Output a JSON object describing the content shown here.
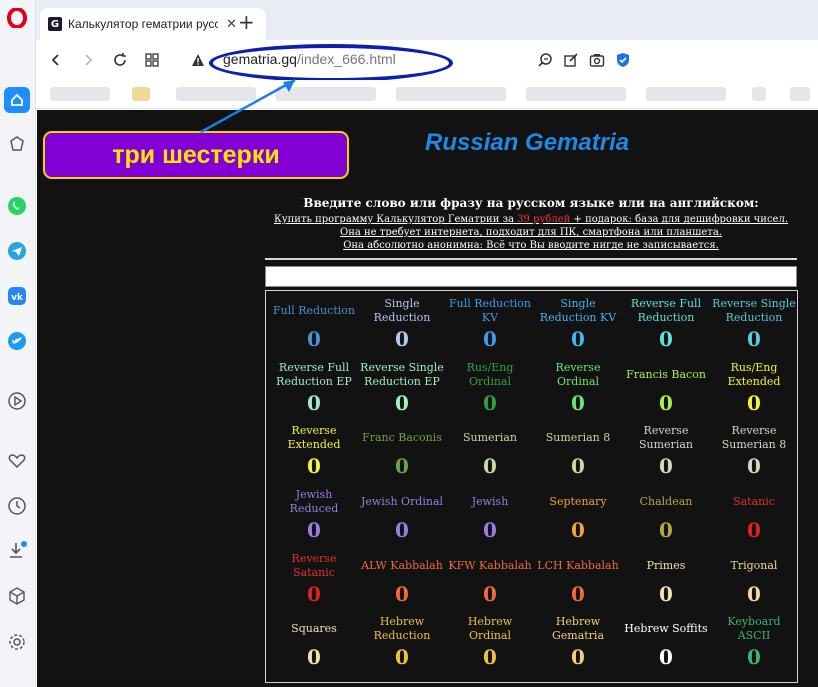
{
  "browser": {
    "tab_title": "Калькулятор гематрии русс",
    "tab_close": "✕",
    "new_tab": "+",
    "url_host": "gematria.gq",
    "url_path": "/index_666.html"
  },
  "page": {
    "site_title": "Russian Gematria",
    "badge_text": "три шестерки",
    "instr_head": "Введите слово или фразу на русском языке или на английском:",
    "instr_line1_a": "Купить программу Калькулятор Гематрии за ",
    "instr_line1_price": "39 рублей",
    "instr_line1_b": " + подарок: база для дешифровки чисел.",
    "instr_line2": "Она не требует интернета, подходит для ПК, смартфона или планшета.",
    "instr_line3": "Она абсолютно анонимна: Всё что Вы вводите нигде не записывается.",
    "input_value": ""
  },
  "ciphers": [
    {
      "label": "Full Reduction",
      "value": "0",
      "label_color": "#4a8fd6",
      "value_color": "#4a8fd6"
    },
    {
      "label": "Single Reduction",
      "value": "0",
      "label_color": "#b8c6ee",
      "value_color": "#b8c6ee"
    },
    {
      "label": "Full Reduction KV",
      "value": "0",
      "label_color": "#3d9be9",
      "value_color": "#3d9be9"
    },
    {
      "label": "Single Reduction KV",
      "value": "0",
      "label_color": "#42b4f0",
      "value_color": "#42b4f0"
    },
    {
      "label": "Reverse Full Reduction",
      "value": "0",
      "label_color": "#5fe0e0",
      "value_color": "#5fe0e0"
    },
    {
      "label": "Reverse Single Reduction",
      "value": "0",
      "label_color": "#5cc8d8",
      "value_color": "#5cc8d8"
    },
    {
      "label": "Reverse Full Reduction EP",
      "value": "0",
      "label_color": "#9ee8c8",
      "value_color": "#9ee8c8"
    },
    {
      "label": "Reverse Single Reduction EP",
      "value": "0",
      "label_color": "#9ef0c0",
      "value_color": "#9ef0c0"
    },
    {
      "label": "Rus/Eng Ordinal",
      "value": "0",
      "label_color": "#2ea043",
      "value_color": "#2ea043"
    },
    {
      "label": "Reverse Ordinal",
      "value": "0",
      "label_color": "#6fe36f",
      "value_color": "#6fe36f"
    },
    {
      "label": "Francis Bacon",
      "value": "0",
      "label_color": "#a8ef4a",
      "value_color": "#a8ef4a"
    },
    {
      "label": "Rus/Eng Extended",
      "value": "0",
      "label_color": "#f2f23c",
      "value_color": "#f2f23c"
    },
    {
      "label": "Reverse Extended",
      "value": "0",
      "label_color": "#f2f23c",
      "value_color": "#f2f23c"
    },
    {
      "label": "Franc Baconis",
      "value": "0",
      "label_color": "#6fa04a",
      "value_color": "#6fa04a"
    },
    {
      "label": "Sumerian",
      "value": "0",
      "label_color": "#c8d8a0",
      "value_color": "#c8d8a0"
    },
    {
      "label": "Sumerian 8",
      "value": "0",
      "label_color": "#c8d8a0",
      "value_color": "#c8d8a0"
    },
    {
      "label": "Reverse Sumerian",
      "value": "0",
      "label_color": "#d6d6c0",
      "value_color": "#d6d6c0"
    },
    {
      "label": "Reverse Sumerian 8",
      "value": "0",
      "label_color": "#d6d6c0",
      "value_color": "#d6d6c0"
    },
    {
      "label": "Jewish Reduced",
      "value": "0",
      "label_color": "#9a7de0",
      "value_color": "#9a7de0"
    },
    {
      "label": "Jewish Ordinal",
      "value": "0",
      "label_color": "#9a7de0",
      "value_color": "#9a7de0"
    },
    {
      "label": "Jewish",
      "value": "0",
      "label_color": "#9a7de0",
      "value_color": "#9a7de0"
    },
    {
      "label": "Septenary",
      "value": "0",
      "label_color": "#f0a040",
      "value_color": "#f0a040"
    },
    {
      "label": "Chaldean",
      "value": "0",
      "label_color": "#b8a640",
      "value_color": "#b8a640"
    },
    {
      "label": "Satanic",
      "value": "0",
      "label_color": "#e03030",
      "value_color": "#e02020"
    },
    {
      "label": "Reverse Satanic",
      "value": "0",
      "label_color": "#e03030",
      "value_color": "#e02020"
    },
    {
      "label": "ALW Kabbalah",
      "value": "0",
      "label_color": "#f06a3a",
      "value_color": "#f06a3a"
    },
    {
      "label": "KFW Kabbalah",
      "value": "0",
      "label_color": "#f06a3a",
      "value_color": "#f06a3a"
    },
    {
      "label": "LCH Kabbalah",
      "value": "0",
      "label_color": "#f06a3a",
      "value_color": "#f06a3a"
    },
    {
      "label": "Primes",
      "value": "0",
      "label_color": "#f0e0b0",
      "value_color": "#f0e0b0"
    },
    {
      "label": "Trigonal",
      "value": "0",
      "label_color": "#f0d8a0",
      "value_color": "#f0d8a0"
    },
    {
      "label": "Squares",
      "value": "0",
      "label_color": "#f0e0b0",
      "value_color": "#f0e0b0"
    },
    {
      "label": "Hebrew Reduction",
      "value": "0",
      "label_color": "#f0c040",
      "value_color": "#f0c040"
    },
    {
      "label": "Hebrew Ordinal",
      "value": "0",
      "label_color": "#f0c040",
      "value_color": "#f0c040"
    },
    {
      "label": "Hebrew Gematria",
      "value": "0",
      "label_color": "#f0d080",
      "value_color": "#f0d080"
    },
    {
      "label": "Hebrew Soffits",
      "value": "0",
      "label_color": "#ffffff",
      "value_color": "#ffffff"
    },
    {
      "label": "Keyboard ASCII",
      "value": "0",
      "label_color": "#3cb371",
      "value_color": "#3cb371"
    }
  ],
  "colors": {
    "page_bg": "#121212",
    "accent_blue": "#1e88e5",
    "badge_bg": "#8200d6",
    "badge_text": "#ffe600",
    "annotation": "#0b1fb0"
  },
  "icons": [
    "opera-logo-icon",
    "home-icon",
    "cube-icon",
    "whatsapp-icon",
    "telegram-icon",
    "vk-icon",
    "twitter-icon",
    "player-icon",
    "heart-icon",
    "clock-icon",
    "download-icon",
    "box-icon",
    "settings-icon",
    "back-icon",
    "forward-icon",
    "reload-icon",
    "speed-dial-icon",
    "warning-icon",
    "search-icon",
    "edit-icon",
    "camera-icon",
    "shield-icon"
  ]
}
